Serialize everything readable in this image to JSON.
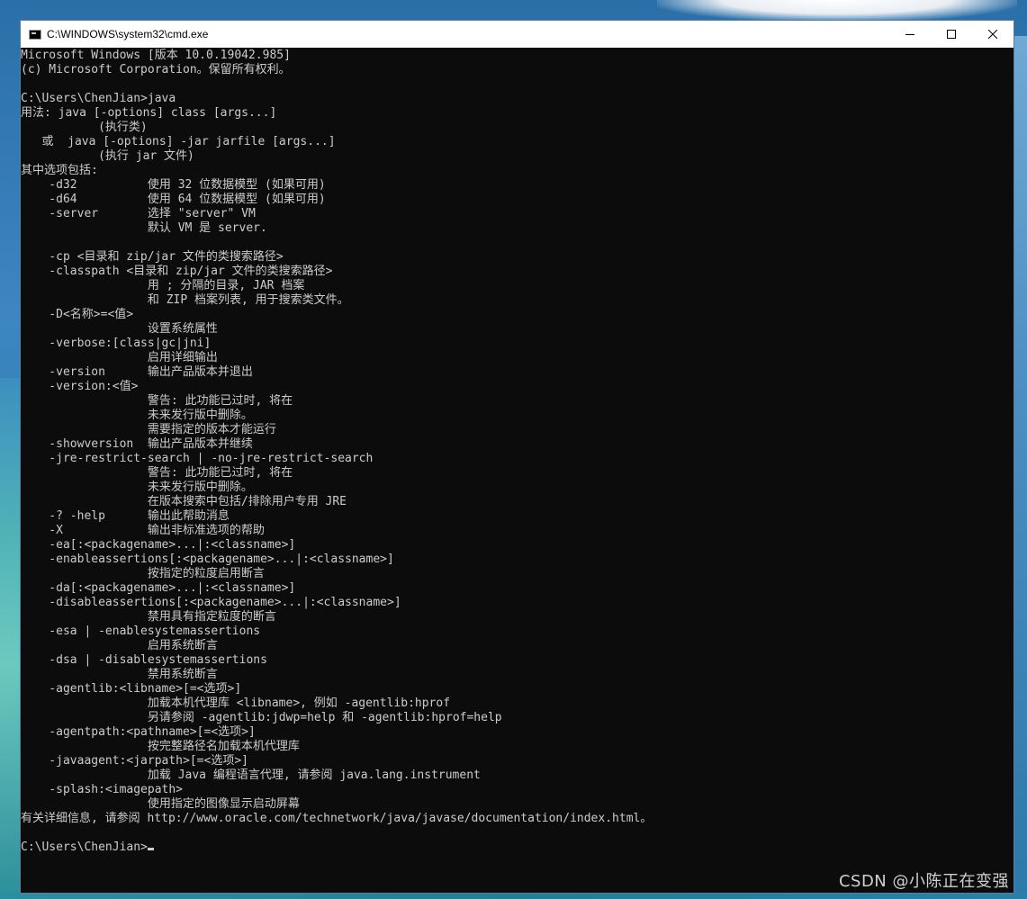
{
  "window": {
    "title": "C:\\WINDOWS\\system32\\cmd.exe",
    "icon": "cmd-icon",
    "controls": [
      "minimize",
      "maximize",
      "close"
    ]
  },
  "console": {
    "lines": [
      "Microsoft Windows [版本 10.0.19042.985]",
      "(c) Microsoft Corporation。保留所有权利。",
      "",
      "C:\\Users\\ChenJian>java",
      "用法: java [-options] class [args...]",
      "           (执行类)",
      "   或  java [-options] -jar jarfile [args...]",
      "           (执行 jar 文件)",
      "其中选项包括:",
      "    -d32          使用 32 位数据模型 (如果可用)",
      "    -d64          使用 64 位数据模型 (如果可用)",
      "    -server       选择 \"server\" VM",
      "                  默认 VM 是 server.",
      "",
      "    -cp <目录和 zip/jar 文件的类搜索路径>",
      "    -classpath <目录和 zip/jar 文件的类搜索路径>",
      "                  用 ; 分隔的目录, JAR 档案",
      "                  和 ZIP 档案列表, 用于搜索类文件。",
      "    -D<名称>=<值>",
      "                  设置系统属性",
      "    -verbose:[class|gc|jni]",
      "                  启用详细输出",
      "    -version      输出产品版本并退出",
      "    -version:<值>",
      "                  警告: 此功能已过时, 将在",
      "                  未来发行版中删除。",
      "                  需要指定的版本才能运行",
      "    -showversion  输出产品版本并继续",
      "    -jre-restrict-search | -no-jre-restrict-search",
      "                  警告: 此功能已过时, 将在",
      "                  未来发行版中删除。",
      "                  在版本搜索中包括/排除用户专用 JRE",
      "    -? -help      输出此帮助消息",
      "    -X            输出非标准选项的帮助",
      "    -ea[:<packagename>...|:<classname>]",
      "    -enableassertions[:<packagename>...|:<classname>]",
      "                  按指定的粒度启用断言",
      "    -da[:<packagename>...|:<classname>]",
      "    -disableassertions[:<packagename>...|:<classname>]",
      "                  禁用具有指定粒度的断言",
      "    -esa | -enablesystemassertions",
      "                  启用系统断言",
      "    -dsa | -disablesystemassertions",
      "                  禁用系统断言",
      "    -agentlib:<libname>[=<选项>]",
      "                  加载本机代理库 <libname>, 例如 -agentlib:hprof",
      "                  另请参阅 -agentlib:jdwp=help 和 -agentlib:hprof=help",
      "    -agentpath:<pathname>[=<选项>]",
      "                  按完整路径名加载本机代理库",
      "    -javaagent:<jarpath>[=<选项>]",
      "                  加载 Java 编程语言代理, 请参阅 java.lang.instrument",
      "    -splash:<imagepath>",
      "                  使用指定的图像显示启动屏幕",
      "有关详细信息, 请参阅 http://www.oracle.com/technetwork/java/javase/documentation/index.html。",
      ""
    ],
    "prompt": "C:\\Users\\ChenJian>"
  },
  "watermark": "CSDN @小陈正在变强",
  "colors": {
    "console_bg": "#0c0c0c",
    "console_fg": "#cccccc",
    "titlebar_bg": "#ffffff"
  }
}
